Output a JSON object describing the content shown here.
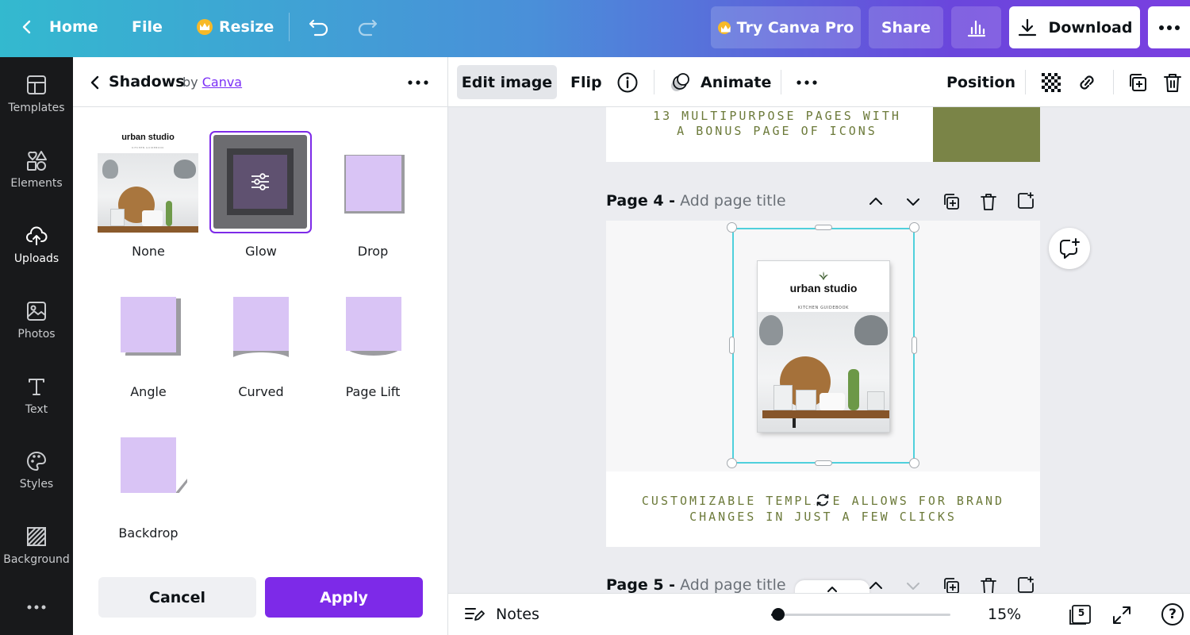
{
  "topbar": {
    "home": "Home",
    "file": "File",
    "resize": "Resize",
    "try_pro": "Try Canva Pro",
    "share": "Share",
    "download": "Download"
  },
  "rail": [
    {
      "label": "Templates",
      "icon": "templates-icon"
    },
    {
      "label": "Elements",
      "icon": "elements-icon"
    },
    {
      "label": "Uploads",
      "icon": "uploads-icon"
    },
    {
      "label": "Photos",
      "icon": "photos-icon"
    },
    {
      "label": "Text",
      "icon": "text-icon"
    },
    {
      "label": "Styles",
      "icon": "styles-icon"
    },
    {
      "label": "Background",
      "icon": "background-icon"
    }
  ],
  "panel": {
    "title": "Shadows",
    "by": "by",
    "by_link": "Canva",
    "thumb_title": "urban studio",
    "thumb_subtitle": "KITCHEN GUIDEBOOK",
    "options": [
      "None",
      "Glow",
      "Drop",
      "Angle",
      "Curved",
      "Page Lift",
      "Backdrop"
    ],
    "selected": "Glow",
    "cancel": "Cancel",
    "apply": "Apply"
  },
  "context": {
    "edit_image": "Edit image",
    "flip": "Flip",
    "animate": "Animate",
    "position": "Position"
  },
  "canvas": {
    "page3_line1": "13 MULTIPURPOSE PAGES WITH",
    "page3_line2": "A BONUS PAGE OF ICONS",
    "page4_num": "Page 4 -",
    "page4_title_placeholder": "Add page title",
    "cover_title": "urban studio",
    "cover_subtitle": "KITCHEN GUIDEBOOK",
    "page4_line1": "CUSTOMIZABLE TEMPLATE ALLOWS FOR BRAND",
    "page4_line2": "CHANGES IN JUST A FEW CLICKS",
    "page5_num": "Page 5 -",
    "page5_title_placeholder": "Add page title",
    "olive_color": "#7a8447"
  },
  "bottom": {
    "notes": "Notes",
    "zoom": "15%",
    "page_count": "5",
    "zoom_fraction": 0.04
  },
  "colors": {
    "accent": "#7d2ae8",
    "selection": "#4fd0dc"
  }
}
